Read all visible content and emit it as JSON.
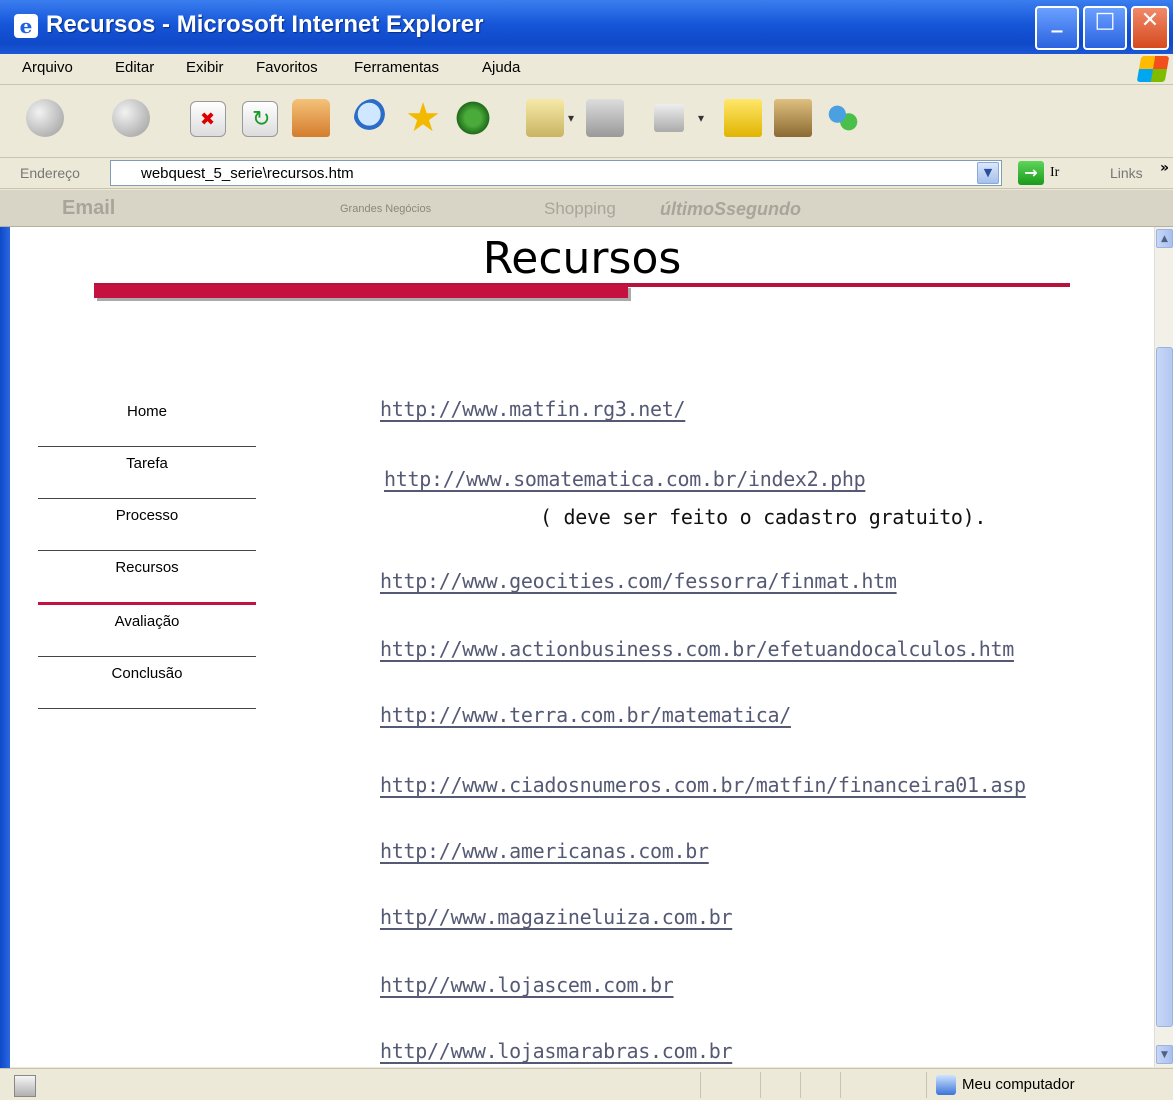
{
  "window": {
    "title": "Recursos - Microsoft Internet Explorer"
  },
  "menu": {
    "items": [
      "Arquivo",
      "Editar",
      "Exibir",
      "Favoritos",
      "Ferramentas",
      "Ajuda"
    ]
  },
  "address": {
    "label": "Endereço",
    "value": "webquest_5_serie\\recursos.htm",
    "go_label": "Ir",
    "links_label": "Links",
    "more": "»"
  },
  "linksbar": {
    "items": [
      "Email",
      "Grandes Negócios",
      "Shopping",
      "últimoSsegundo"
    ]
  },
  "page": {
    "title": "Recursos",
    "nav": [
      "Home",
      "Tarefa",
      "Processo",
      "Recursos",
      "Avaliação",
      "Conclusão"
    ],
    "active_nav": "Recursos",
    "links": [
      "http://www.matfin.rg3.net/",
      "http://www.somatematica.com.br/index2.php",
      "http://www.geocities.com/fessorra/finmat.htm",
      "http://www.actionbusiness.com.br/efetuandocalculos.htm",
      "http://www.terra.com.br/matematica/",
      "http://www.ciadosnumeros.com.br/matfin/financeira01.asp",
      "http://www.americanas.com.br",
      "http//www.magazineluiza.com.br",
      "http//www.lojascem.com.br",
      "http//www.lojasmarabras.com.br"
    ],
    "note": "( deve ser feito o cadastro gratuito)."
  },
  "status": {
    "zone": "Meu computador"
  },
  "colors": {
    "accent_red": "#c4113f",
    "link": "#555a74",
    "xp_blue": "#1656d8"
  },
  "icons": [
    "ie-icon",
    "back-icon",
    "forward-icon",
    "stop-icon",
    "refresh-icon",
    "home-icon",
    "search-icon",
    "favorites-icon",
    "media-icon",
    "mail-icon",
    "print-icon",
    "edit-icon",
    "note-icon",
    "research-icon",
    "messenger-icon"
  ]
}
